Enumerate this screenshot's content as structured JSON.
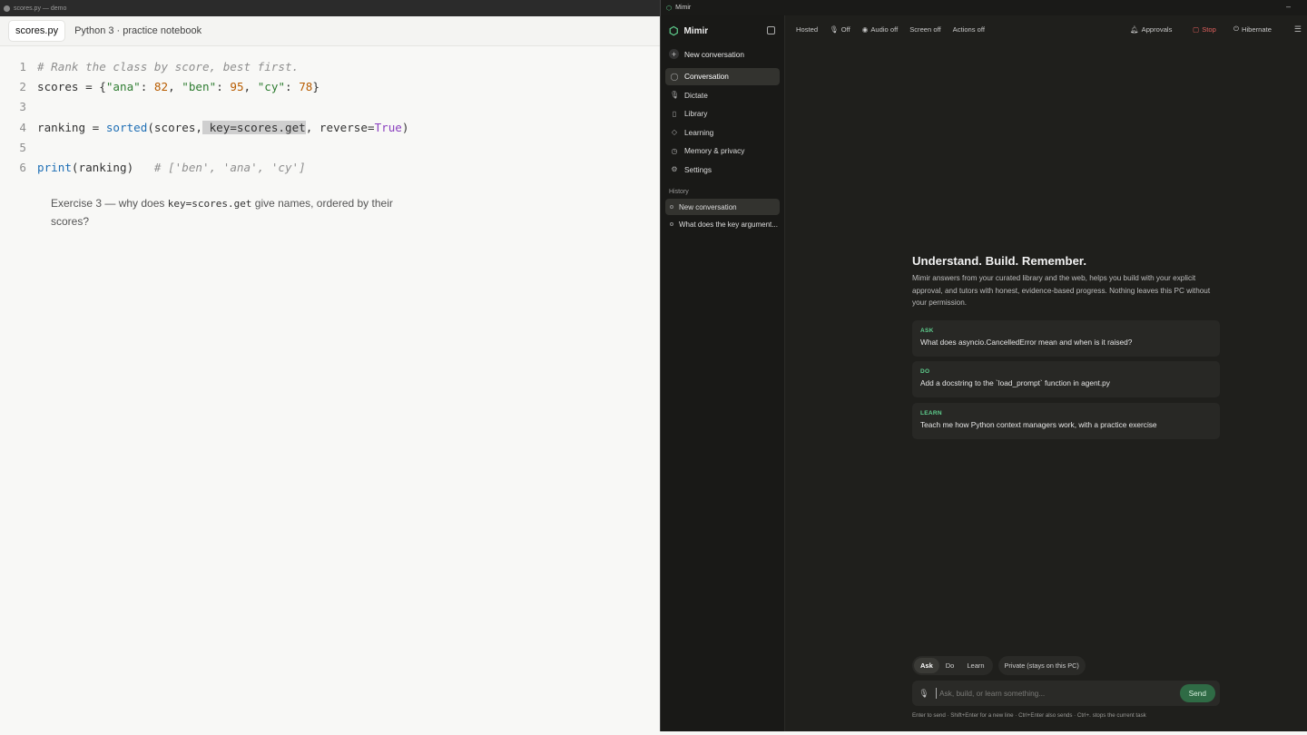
{
  "editor": {
    "window_title": "scores.py — demo",
    "tabs": [
      "scores.py",
      "Python 3 · practice notebook"
    ],
    "line_numbers": [
      "1",
      "2",
      "3",
      "4",
      "5",
      "6"
    ],
    "code": {
      "l1": "# Rank the class by score, best first.",
      "l2_var": "scores = {",
      "l2_k1": "\"ana\"",
      "l2_v1": "82",
      "l2_k2": "\"ben\"",
      "l2_v2": "95",
      "l2_k3": "\"cy\"",
      "l2_v3": "78",
      "l4_a": "ranking = ",
      "l4_fn": "sorted",
      "l4_b": "(scores,",
      "l4_hl": " key=scores.get",
      "l4_c": ", reverse=",
      "l4_kw": "True",
      "l4_d": ")",
      "l6_fn": "print",
      "l6_a": "(ranking)",
      "l6_cm": "   # ['ben', 'ana', 'cy']"
    },
    "exercise": {
      "pre": "Exercise 3 — why does ",
      "code": "key=scores.get",
      "post": " give names, ordered by their scores?"
    }
  },
  "mimir": {
    "window_title": "Mimir",
    "app_name": "Mimir",
    "new_conversation": "New conversation",
    "nav": [
      "Conversation",
      "Dictate",
      "Library",
      "Learning",
      "Memory & privacy",
      "Settings"
    ],
    "history_label": "History",
    "history": [
      "New conversation",
      "What does the key argument..."
    ],
    "topbar": {
      "hosted": "Hosted",
      "mic": "Off",
      "audio": "Audio off",
      "screen": "Screen off",
      "actions": "Actions off",
      "approvals": "Approvals",
      "stop": "Stop",
      "hibernate": "Hibernate"
    },
    "hero": {
      "title": "Understand. Build. Remember.",
      "description": "Mimir answers from your curated library and the web, helps you build with your explicit approval, and tutors with honest, evidence-based progress. Nothing leaves this PC without your permission."
    },
    "cards": [
      {
        "tag": "ASK",
        "text": "What does asyncio.CancelledError mean and when is it raised?"
      },
      {
        "tag": "DO",
        "text": "Add a docstring to the `load_prompt` function in agent.py"
      },
      {
        "tag": "LEARN",
        "text": "Teach me how Python context managers work, with a practice exercise"
      }
    ],
    "modes": [
      "Ask",
      "Do",
      "Learn"
    ],
    "active_mode": "Ask",
    "private_label": "Private (stays on this PC)",
    "composer": {
      "placeholder": "Ask, build, or learn something...",
      "value": "",
      "send": "Send"
    },
    "hint": "Enter to send · Shift+Enter for a new line · Ctrl+Enter also sends · Ctrl+. stops the current task"
  }
}
